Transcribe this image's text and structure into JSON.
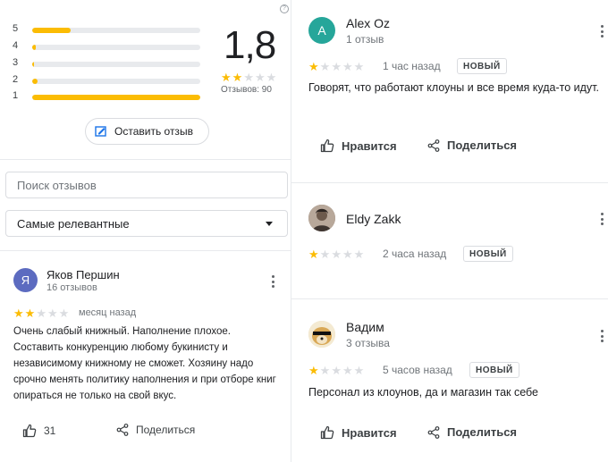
{
  "summary": {
    "help_icon": "?",
    "bars": [
      {
        "label": "5",
        "fraction": 0.23
      },
      {
        "label": "4",
        "fraction": 0.02
      },
      {
        "label": "3",
        "fraction": 0.01
      },
      {
        "label": "2",
        "fraction": 0.03
      },
      {
        "label": "1",
        "fraction": 1.0
      }
    ],
    "rating": "1,8",
    "stars_filled": 2,
    "reviews_count_text": "Отзывов: 90",
    "write_review_label": "Оставить отзыв",
    "accent_color": "#fbbc04"
  },
  "search": {
    "placeholder": "Поиск отзывов"
  },
  "sort": {
    "selected": "Самые релевантные"
  },
  "reviews_left": [
    {
      "avatar_letter": "Я",
      "avatar_color": "#5c6bc0",
      "name": "Яков Першин",
      "meta": "16 отзывов",
      "stars": 2,
      "time": "месяц назад",
      "text": "Очень слабый книжный. Наполнение плохое. Составить конкуренцию любому букинисту и независимому книжному не сможет. Хозяину надо срочно менять политику наполнения и при отборе книг опираться не только на свой вкус.",
      "likes": "31",
      "share_label": "Поделиться"
    }
  ],
  "reviews_right": [
    {
      "avatar_letter": "A",
      "avatar_color": "#26a69a",
      "name": "Alex Oz",
      "meta": "1 отзыв",
      "stars": 1,
      "time": "1 час назад",
      "badge": "НОВЫЙ",
      "text": "Говорят, что работают клоуны и все время куда-то идут.",
      "like_label": "Нравится",
      "share_label": "Поделиться"
    },
    {
      "avatar_letter": "",
      "name": "Eldy Zakk",
      "meta": "",
      "stars": 1,
      "time": "2 часа назад",
      "badge": "НОВЫЙ"
    },
    {
      "avatar_letter": "",
      "name": "Вадим",
      "meta": "3 отзыва",
      "stars": 1,
      "time": "5 часов назад",
      "badge": "НОВЫЙ",
      "text": "Персонал из клоунов, да и магазин так себе",
      "like_label": "Нравится",
      "share_label": "Поделиться"
    }
  ]
}
